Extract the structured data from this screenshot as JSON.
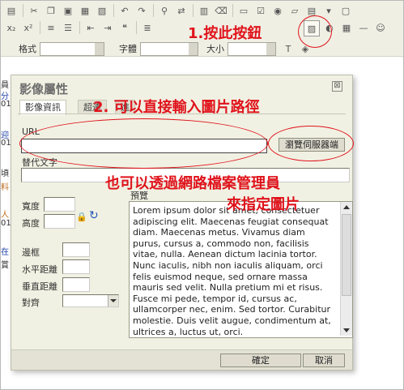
{
  "toolbar": {
    "row1_icons": [
      "html-icon",
      "cut-icon",
      "copy-icon",
      "paste-icon",
      "paste-text-icon",
      "paste-word-icon",
      "undo-icon",
      "redo-icon",
      "find-icon",
      "replace-icon",
      "select-all-icon",
      "remove-format-icon",
      "form-icon",
      "checkbox-icon",
      "radio-icon",
      "textfield-icon",
      "textarea-icon"
    ],
    "row2_icons": [
      "subscript-icon",
      "superscript-icon",
      "ordered-list-icon",
      "unordered-list-icon",
      "outdent-icon",
      "indent-icon",
      "blockquote-icon",
      "align-left-icon"
    ],
    "row2_right_icons": [
      "image-icon",
      "flash-icon",
      "table-icon",
      "hr-icon",
      "smiley-icon"
    ],
    "format_label": "格式",
    "font_label": "字體",
    "size_label": "大小"
  },
  "editor_strip": [
    "員",
    "分",
    "01",
    "迎",
    "01",
    "頃",
    "料",
    "人",
    "01",
    "在",
    "賞"
  ],
  "dialog": {
    "title": "影像屬性",
    "close": "⊠",
    "tabs": [
      {
        "label": "影像資訊",
        "active": true
      },
      {
        "label": "超連",
        "active": false
      },
      {
        "label": "進",
        "active": false
      }
    ],
    "url_label": "URL",
    "url_value": "",
    "browse_button": "瀏覽伺服器端",
    "alt_label": "替代文字",
    "alt_value": "",
    "width_label": "寬度",
    "height_label": "高度",
    "border_label": "邊框",
    "hspace_label": "水平距離",
    "vspace_label": "垂直距離",
    "align_label": "對齊",
    "preview_label": "預覽",
    "preview_text": "Lorem ipsum dolor sit amet, consectetuer adipiscing elit. Maecenas feugiat consequat diam. Maecenas metus. Vivamus diam purus, cursus a, commodo non, facilisis vitae, nulla. Aenean dictum lacinia tortor. Nunc iaculis, nibh non iaculis aliquam, orci felis euismod neque, sed ornare massa mauris sed velit. Nulla pretium mi et risus. Fusce mi pede, tempor id, cursus ac, ullamcorper nec, enim. Sed tortor. Curabitur molestie. Duis velit augue, condimentum at, ultrices a, luctus ut, orci.",
    "ok_button": "確定",
    "cancel_button": "取消"
  },
  "annotations": {
    "step1": "1.按此按鈕",
    "step2": "2. 可以直接輸入圖片路徑",
    "step3_line1": "也可以透過網路檔案管理員",
    "step3_line2": "來指定圖片",
    "color": "#e0131b"
  }
}
